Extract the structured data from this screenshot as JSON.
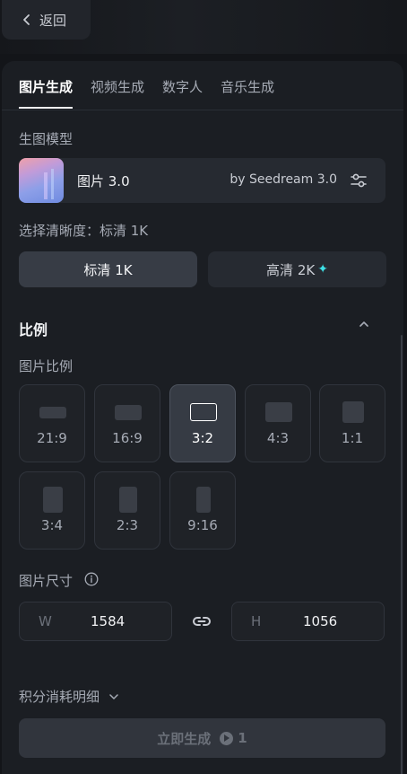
{
  "back": {
    "label": "返回"
  },
  "tabs": [
    {
      "label": "图片生成",
      "active": true
    },
    {
      "label": "视频生成",
      "active": false
    },
    {
      "label": "数字人",
      "active": false
    },
    {
      "label": "音乐生成",
      "active": false
    }
  ],
  "model_section": {
    "label": "生图模型"
  },
  "model": {
    "name": "图片 3.0",
    "by": "by Seedream 3.0",
    "settings_icon": "sliders-icon"
  },
  "quality": {
    "label": "选择清晰度：标清 1K",
    "options": [
      {
        "label": "标清 1K",
        "selected": true
      },
      {
        "label": "高清 2K",
        "selected": false,
        "badge": "✦"
      }
    ]
  },
  "ratio_section": {
    "title": "比例",
    "subtitle": "图片比例"
  },
  "ratios": [
    {
      "label": "21:9",
      "selected": false
    },
    {
      "label": "16:9",
      "selected": false
    },
    {
      "label": "3:2",
      "selected": true
    },
    {
      "label": "4:3",
      "selected": false
    },
    {
      "label": "1:1",
      "selected": false
    },
    {
      "label": "3:4",
      "selected": false
    },
    {
      "label": "2:3",
      "selected": false
    },
    {
      "label": "9:16",
      "selected": false
    }
  ],
  "size": {
    "label": "图片尺寸",
    "width_label": "W",
    "width_value": "1584",
    "height_label": "H",
    "height_value": "1056"
  },
  "cost": {
    "label": "积分消耗明细"
  },
  "generate": {
    "label": "立即生成",
    "credits": "1"
  },
  "colors": {
    "accent_sparkle": "#3ee0e6",
    "panel": "#1b1e23",
    "background": "#131519"
  }
}
